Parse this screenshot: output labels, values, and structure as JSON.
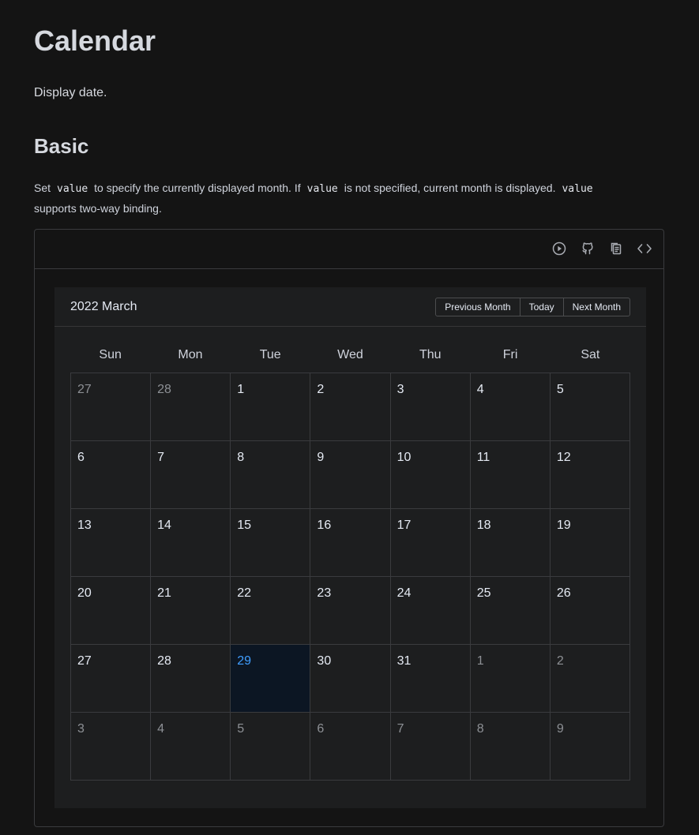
{
  "page": {
    "title": "Calendar",
    "description": "Display date."
  },
  "section": {
    "title": "Basic",
    "desc_parts": [
      "Set",
      "value",
      "to specify the currently displayed month. If",
      "value",
      "is not specified, current month is displayed.",
      "value",
      "supports two-way binding."
    ]
  },
  "toolbar": {
    "icons": [
      "play-circle-icon",
      "github-icon",
      "copy-icon",
      "code-icon"
    ]
  },
  "calendar": {
    "title": "2022 March",
    "buttons": {
      "prev": "Previous Month",
      "today": "Today",
      "next": "Next Month"
    },
    "weekdays": [
      "Sun",
      "Mon",
      "Tue",
      "Wed",
      "Thu",
      "Fri",
      "Sat"
    ],
    "days": [
      {
        "d": "27",
        "m": "prev"
      },
      {
        "d": "28",
        "m": "prev"
      },
      {
        "d": "1",
        "m": "cur"
      },
      {
        "d": "2",
        "m": "cur"
      },
      {
        "d": "3",
        "m": "cur"
      },
      {
        "d": "4",
        "m": "cur"
      },
      {
        "d": "5",
        "m": "cur"
      },
      {
        "d": "6",
        "m": "cur"
      },
      {
        "d": "7",
        "m": "cur"
      },
      {
        "d": "8",
        "m": "cur"
      },
      {
        "d": "9",
        "m": "cur"
      },
      {
        "d": "10",
        "m": "cur"
      },
      {
        "d": "11",
        "m": "cur"
      },
      {
        "d": "12",
        "m": "cur"
      },
      {
        "d": "13",
        "m": "cur"
      },
      {
        "d": "14",
        "m": "cur"
      },
      {
        "d": "15",
        "m": "cur"
      },
      {
        "d": "16",
        "m": "cur"
      },
      {
        "d": "17",
        "m": "cur"
      },
      {
        "d": "18",
        "m": "cur"
      },
      {
        "d": "19",
        "m": "cur"
      },
      {
        "d": "20",
        "m": "cur"
      },
      {
        "d": "21",
        "m": "cur"
      },
      {
        "d": "22",
        "m": "cur"
      },
      {
        "d": "23",
        "m": "cur"
      },
      {
        "d": "24",
        "m": "cur"
      },
      {
        "d": "25",
        "m": "cur"
      },
      {
        "d": "26",
        "m": "cur"
      },
      {
        "d": "27",
        "m": "cur"
      },
      {
        "d": "28",
        "m": "cur"
      },
      {
        "d": "29",
        "m": "cur",
        "selected": true
      },
      {
        "d": "30",
        "m": "cur"
      },
      {
        "d": "31",
        "m": "cur"
      },
      {
        "d": "1",
        "m": "next"
      },
      {
        "d": "2",
        "m": "next"
      },
      {
        "d": "3",
        "m": "next"
      },
      {
        "d": "4",
        "m": "next"
      },
      {
        "d": "5",
        "m": "next"
      },
      {
        "d": "6",
        "m": "next"
      },
      {
        "d": "7",
        "m": "next"
      },
      {
        "d": "8",
        "m": "next"
      },
      {
        "d": "9",
        "m": "next"
      }
    ]
  },
  "colors": {
    "background": "#141414",
    "calendar_bg": "#1d1e1f",
    "selected_bg": "#0c1623",
    "accent": "#409eff",
    "muted_text": "#8d9095"
  }
}
